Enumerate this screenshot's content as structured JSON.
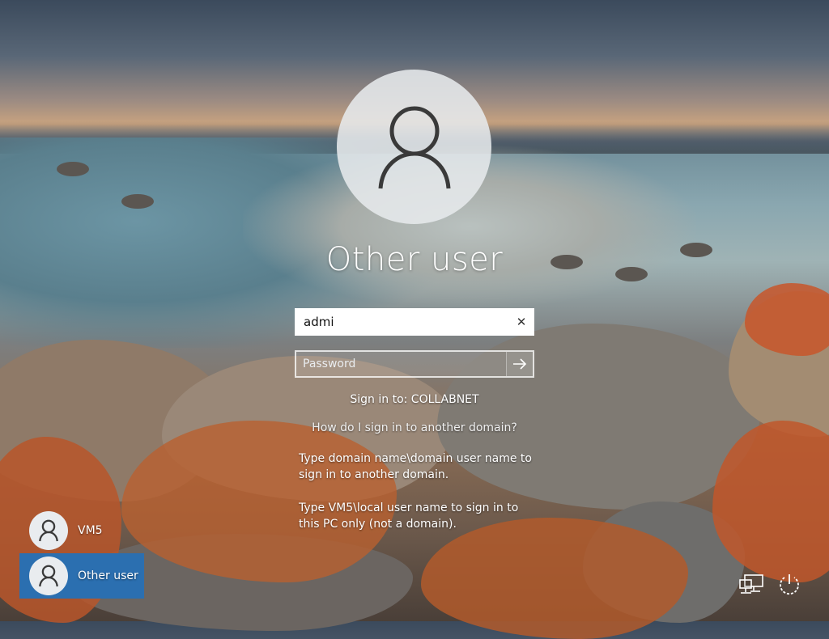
{
  "signin": {
    "title": "Other user",
    "username_value": "admi",
    "username_clear_icon": "close-icon",
    "password_placeholder": "Password",
    "submit_icon": "arrow-right-icon",
    "sign_in_to": "Sign in to: COLLABNET",
    "help_link": "How do I sign in to another domain?",
    "help_text_1": "Type domain name\\domain user name to sign in to another domain.",
    "help_text_2": "Type VM5\\local user name to sign in to this PC only (not a domain)."
  },
  "users": [
    {
      "label": "VM5",
      "icon": "user-icon",
      "selected": false
    },
    {
      "label": "Other user",
      "icon": "user-icon",
      "selected": true
    }
  ],
  "corner": {
    "network_icon": "network-icon",
    "power_icon": "power-icon"
  },
  "colors": {
    "selected_tile": "#2b6fb0",
    "avatar_bg": "#e6e9ec",
    "avatar_glyph": "#3a3a3a"
  }
}
